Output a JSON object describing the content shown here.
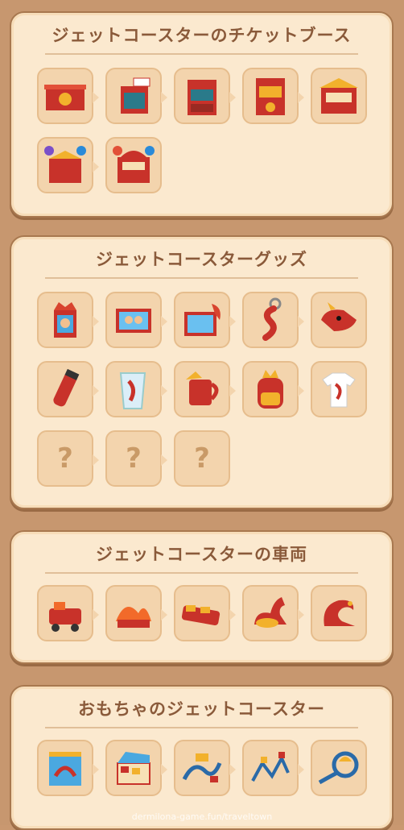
{
  "sections": [
    {
      "title": "ジェットコースターのチケットブース"
    },
    {
      "title": "ジェットコースターグッズ"
    },
    {
      "title": "ジェットコースターの車両"
    },
    {
      "title": "おもちゃのジェットコースター"
    }
  ],
  "locked_mark": "?",
  "watermark": "dermilona-game.fun/traveltown",
  "colors": {
    "panel": "#fbe9cf",
    "tile": "#f3d4ad",
    "title": "#8a5a3a",
    "background": "#c7976f"
  }
}
